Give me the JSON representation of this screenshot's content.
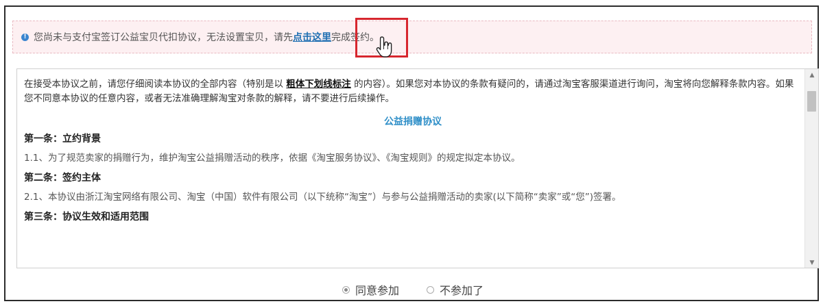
{
  "notice": {
    "text_before": "您尚未与支付宝签订公益宝贝代扣协议，无法设置宝贝，请先",
    "link_text": "点击这里",
    "text_after": "完成签约。"
  },
  "agreement": {
    "intro_before": "在接受本协议之前，请您仔细阅读本协议的全部内容（特别是以 ",
    "intro_bold": "粗体下划线标注",
    "intro_after": " 的内容）。如果您对本协议的条款有疑问的，请通过淘宝客服渠道进行询问，淘宝将向您解释条款内容。如果您不同意本协议的任意内容，或者无法准确理解淘宝对条款的解释，请不要进行后续操作。",
    "title": "公益捐赠协议",
    "sections": [
      {
        "heading": "第一条：立约背景",
        "clause": "1.1、为了规范卖家的捐赠行为，维护淘宝公益捐赠活动的秩序，依据《淘宝服务协议》、《淘宝规则》的规定拟定本协议。"
      },
      {
        "heading": "第二条：签约主体",
        "clause": "2.1、本协议由浙江淘宝网络有限公司、淘宝（中国）软件有限公司（以下统称“淘宝”）与参与公益捐赠活动的卖家(以下简称“卖家”或“您”)签署。"
      },
      {
        "heading": "第三条：协议生效和适用范围",
        "clause": ""
      }
    ]
  },
  "options": {
    "agree_label": "同意参加",
    "decline_label": "不参加了",
    "selected": "agree"
  },
  "colors": {
    "link": "#1f6fb2",
    "title": "#2f8fc8",
    "highlight": "#d7262e",
    "notice_bg": "#fdf0f2"
  },
  "icons": {
    "notice": "info-icon",
    "cursor": "hand-pointer-icon"
  }
}
